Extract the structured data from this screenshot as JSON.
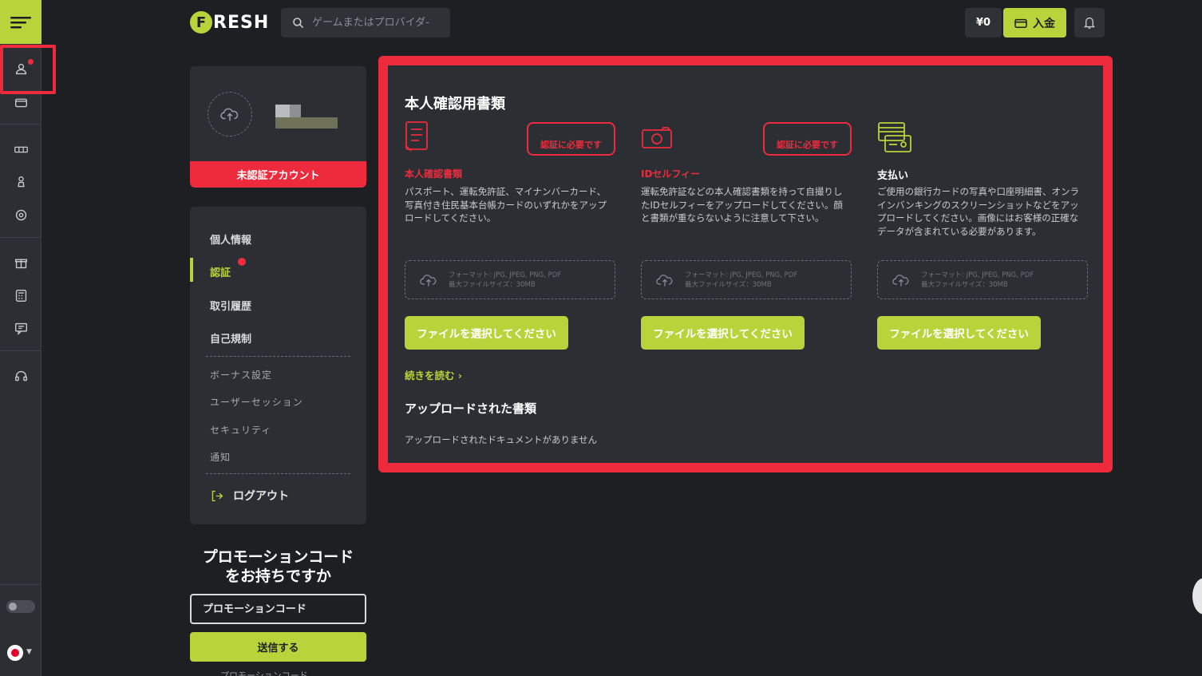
{
  "header": {
    "logo_letter": "F",
    "logo_text": "RESH",
    "search_placeholder": "ゲームまたはプロバイダ-",
    "balance": "¥0",
    "deposit_label": "入金"
  },
  "profile": {
    "status_label": "未認証アカウント"
  },
  "sidenav": {
    "main_items": [
      "個人情報",
      "認証",
      "取引履歴",
      "自己規制"
    ],
    "sub_items": [
      "ボーナス設定",
      "ユーザーセッション",
      "セキュリティ",
      "通知"
    ],
    "logout_label": "ログアウト",
    "active_index": 1
  },
  "promo": {
    "title_line1": "プロモーションコード",
    "title_line2": "をお持ちですか",
    "input_placeholder": "プロモーションコード",
    "submit_label": "送信する",
    "footer_text": "プロモーションコード..."
  },
  "main": {
    "title": "本人確認用書類",
    "columns": [
      {
        "icon": "document-icon",
        "required_badge": "認証に必要です",
        "heading": "本人確認書類",
        "heading_color": "#ee2b3c",
        "description": "パスポート、運転免許証、マイナンバーカード、写真付き住民基本台帳カードのいずれかをアップロードしてください。",
        "dropzone_line1": "フォーマット: JPG, JPEG, PNG, PDF",
        "dropzone_line2": "最大ファイルサイズ：30MB",
        "button_label": "ファイルを選択してください"
      },
      {
        "icon": "camera-icon",
        "required_badge": "認証に必要です",
        "heading": "IDセルフィー",
        "heading_color": "#ee2b3c",
        "description": "運転免許証などの本人確認書類を持って自撮りしたIDセルフィーをアップロードしてください。顔と書類が重ならないように注意して下さい。",
        "dropzone_line1": "フォーマット: JPG, JPEG, PNG, PDF",
        "dropzone_line2": "最大ファイルサイズ：30MB",
        "button_label": "ファイルを選択してください"
      },
      {
        "icon": "payment-card-icon",
        "required_badge": "",
        "heading": "支払い",
        "heading_color": "#ffffff",
        "description": "ご使用の銀行カードの写真や口座明細書、オンラインバンキングのスクリーンショットなどをアップロードしてください。画像にはお客様の正確なデータが含まれている必要があります。",
        "dropzone_line1": "フォーマット: JPG, JPEG, PNG, PDF",
        "dropzone_line2": "最大ファイルサイズ：30MB",
        "button_label": "ファイルを選択してください"
      }
    ],
    "read_more": "続きを読む ›",
    "uploaded_title": "アップロードされた書類",
    "uploaded_empty": "アップロードされたドキュメントがありません"
  },
  "colors": {
    "accent": "#b8d43a",
    "alert": "#ee2b3c",
    "background": "#1d1f23",
    "panel": "#2b2e33"
  }
}
